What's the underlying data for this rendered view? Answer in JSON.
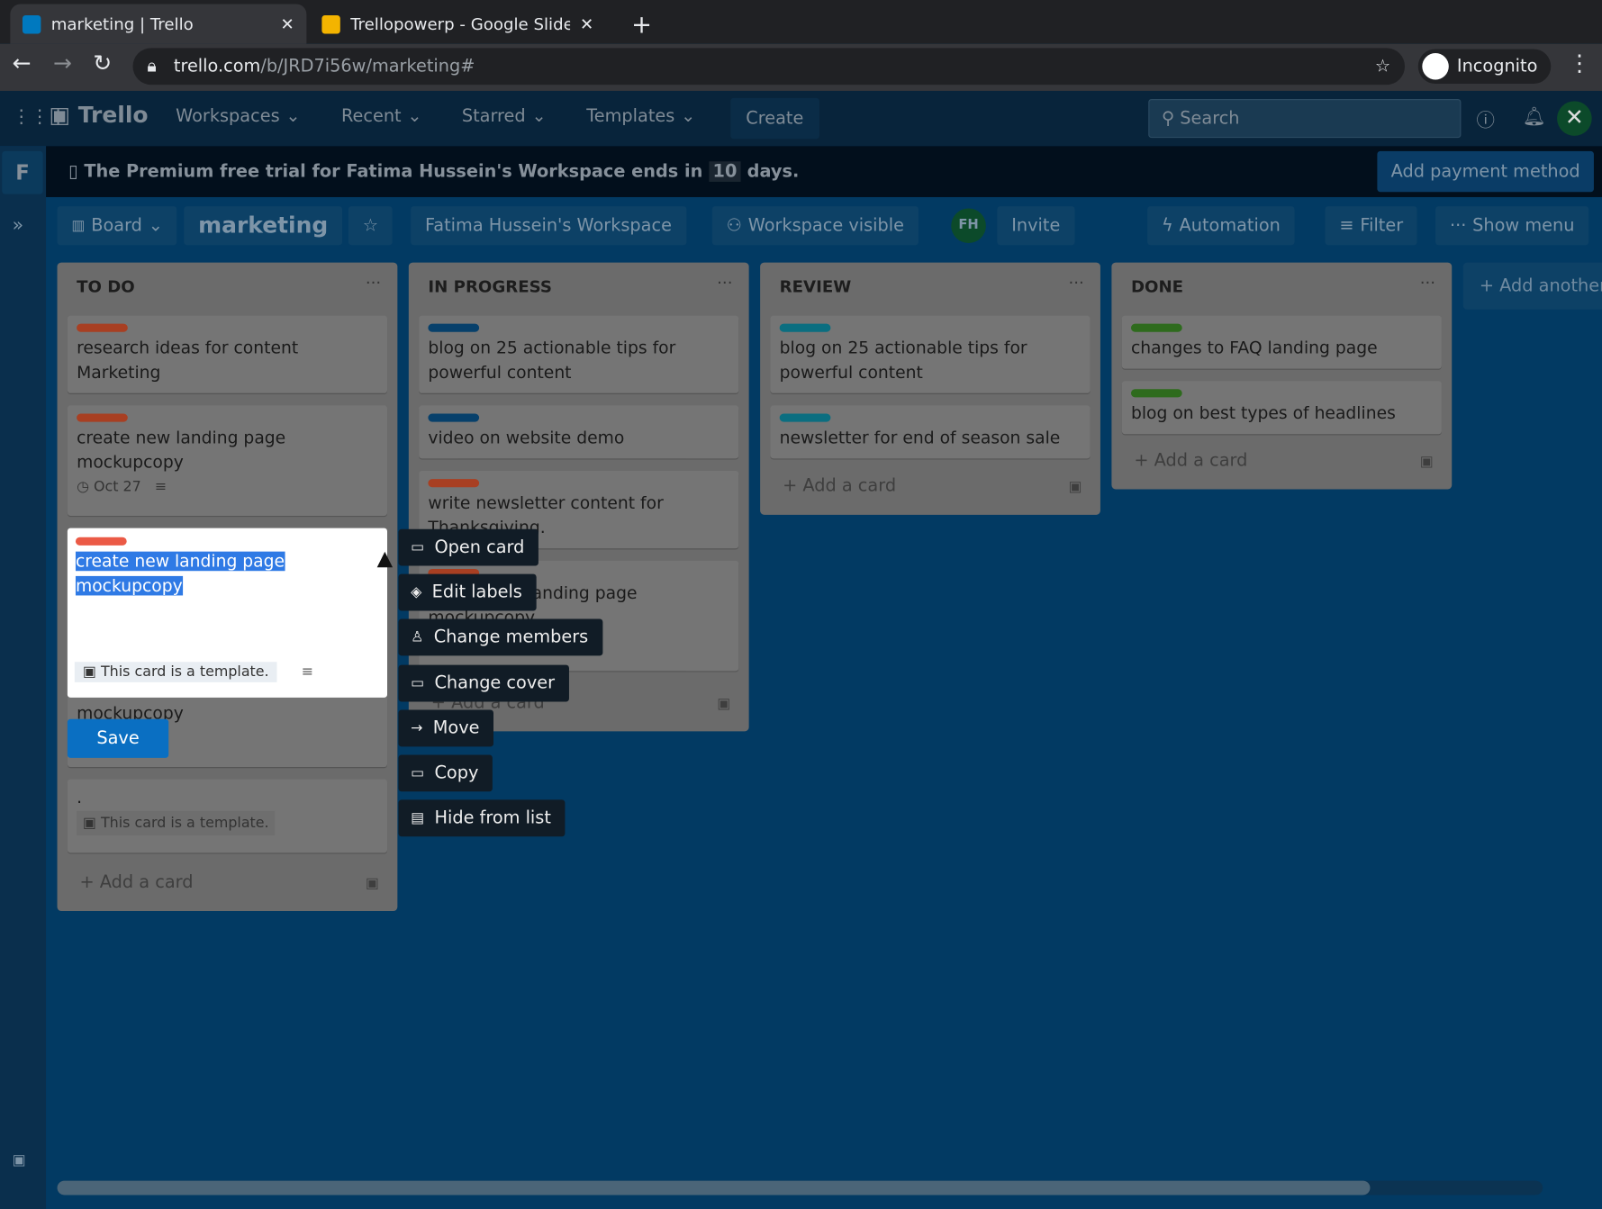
{
  "browser": {
    "tabs": [
      {
        "title": "marketing | Trello"
      },
      {
        "title": "Trellopowerp - Google Slide"
      }
    ],
    "url_host": "trello.com",
    "url_path": "/b/JRD7i56w/marketing#",
    "profile": "Incognito"
  },
  "header": {
    "logo": "Trello",
    "nav": [
      "Workspaces",
      "Recent",
      "Starred",
      "Templates"
    ],
    "create": "Create",
    "search_placeholder": "Search",
    "avatar": "FH"
  },
  "banner": {
    "text_before": "The Premium free trial for Fatima Hussein's Workspace ends in",
    "days": "10",
    "text_after": "days.",
    "button": "Add payment method"
  },
  "sidebar": {
    "initial": "F"
  },
  "board": {
    "view": "Board",
    "name": "marketing",
    "workspace": "Fatima Hussein's Workspace",
    "visibility": "Workspace visible",
    "member": "FH",
    "invite": "Invite",
    "automation": "Automation",
    "filter": "Filter",
    "show_menu": "Show menu",
    "add_list": "Add another list"
  },
  "lists": [
    {
      "title": "TO DO",
      "cards": [
        {
          "text": "research ideas for content Marketing",
          "label": "#a83f22"
        },
        {
          "text": "create new landing page mockupcopy",
          "label": "#a83f22",
          "date": "Oct 27"
        },
        {
          "text": "mockupcopy"
        },
        {
          "text": ".",
          "badge": "This card is a template."
        }
      ],
      "add": "Add a card"
    },
    {
      "title": "IN PROGRESS",
      "cards": [
        {
          "text": "blog on 25 actionable tips for powerful content",
          "label": "#07406b"
        },
        {
          "text": "video on website demo",
          "label": "#07406b"
        },
        {
          "text": "write newsletter content for Thanksgiving.",
          "label": "#a83f22"
        },
        {
          "text": "create new landing page mockupcopy",
          "label": "#a83f22"
        }
      ],
      "add": "Add a card"
    },
    {
      "title": "REVIEW",
      "cards": [
        {
          "text": "blog on 25 actionable tips for powerful content",
          "label": "#0b6e80"
        },
        {
          "text": "newsletter for end of season sale",
          "label": "#0b6e80"
        }
      ],
      "add": "Add a card"
    },
    {
      "title": "DONE",
      "cards": [
        {
          "text": "changes to FAQ landing page",
          "label": "#2e6b1d"
        },
        {
          "text": "blog on best types of headlines",
          "label": "#2e6b1d"
        }
      ],
      "add": "Add a card"
    }
  ],
  "editor": {
    "text": "create new landing page mockupcopy",
    "badge": "This card is a template.",
    "save": "Save",
    "label": "#eb5a46"
  },
  "menu": [
    "Open card",
    "Edit labels",
    "Change members",
    "Change cover",
    "Move",
    "Copy",
    "Hide from list"
  ]
}
